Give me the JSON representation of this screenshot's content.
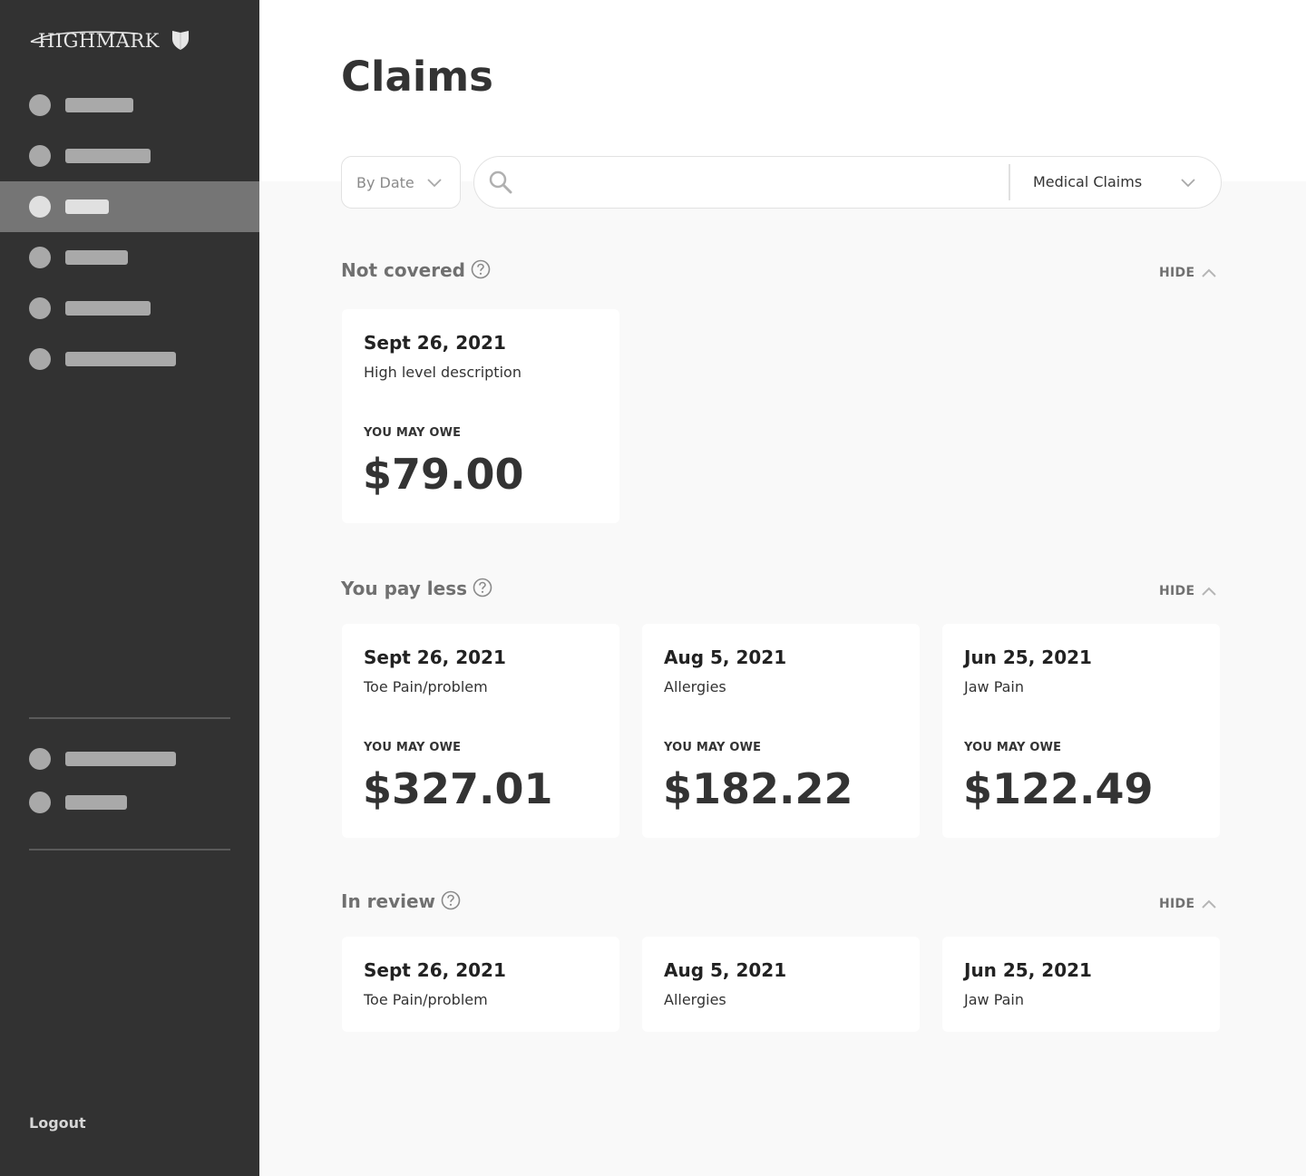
{
  "brand": {
    "logo_text": "HIGHMARK",
    "logout_label": "Logout"
  },
  "page": {
    "title": "Claims"
  },
  "filters": {
    "sort_label": "By Date",
    "search_placeholder": "",
    "claim_type_label": "Medical Claims"
  },
  "sections": [
    {
      "title": "Not covered",
      "toggle_label": "HIDE",
      "cards": [
        {
          "date": "Sept 26, 2021",
          "description": "High level description",
          "owe_label": "YOU MAY OWE",
          "amount": "$79.00"
        }
      ]
    },
    {
      "title": "You pay less",
      "toggle_label": "HIDE",
      "cards": [
        {
          "date": "Sept 26, 2021",
          "description": "Toe Pain/problem",
          "owe_label": "YOU MAY OWE",
          "amount": "$327.01"
        },
        {
          "date": "Aug 5, 2021",
          "description": "Allergies",
          "owe_label": "YOU MAY OWE",
          "amount": "$182.22"
        },
        {
          "date": "Jun 25, 2021",
          "description": "Jaw Pain",
          "owe_label": "YOU MAY OWE",
          "amount": "$122.49"
        }
      ]
    },
    {
      "title": "In review",
      "toggle_label": "HIDE",
      "cards": [
        {
          "date": "Sept 26, 2021",
          "description": "Toe Pain/problem"
        },
        {
          "date": "Aug 5, 2021",
          "description": "Allergies"
        },
        {
          "date": "Jun 25, 2021",
          "description": "Jaw Pain"
        }
      ]
    }
  ],
  "colors": {
    "sidebar_bg": "#323232",
    "sidebar_active": "#757575",
    "page_bg": "#f9f9f9",
    "card_bg": "#ffffff",
    "text_primary": "#333333",
    "text_muted": "#707070"
  }
}
